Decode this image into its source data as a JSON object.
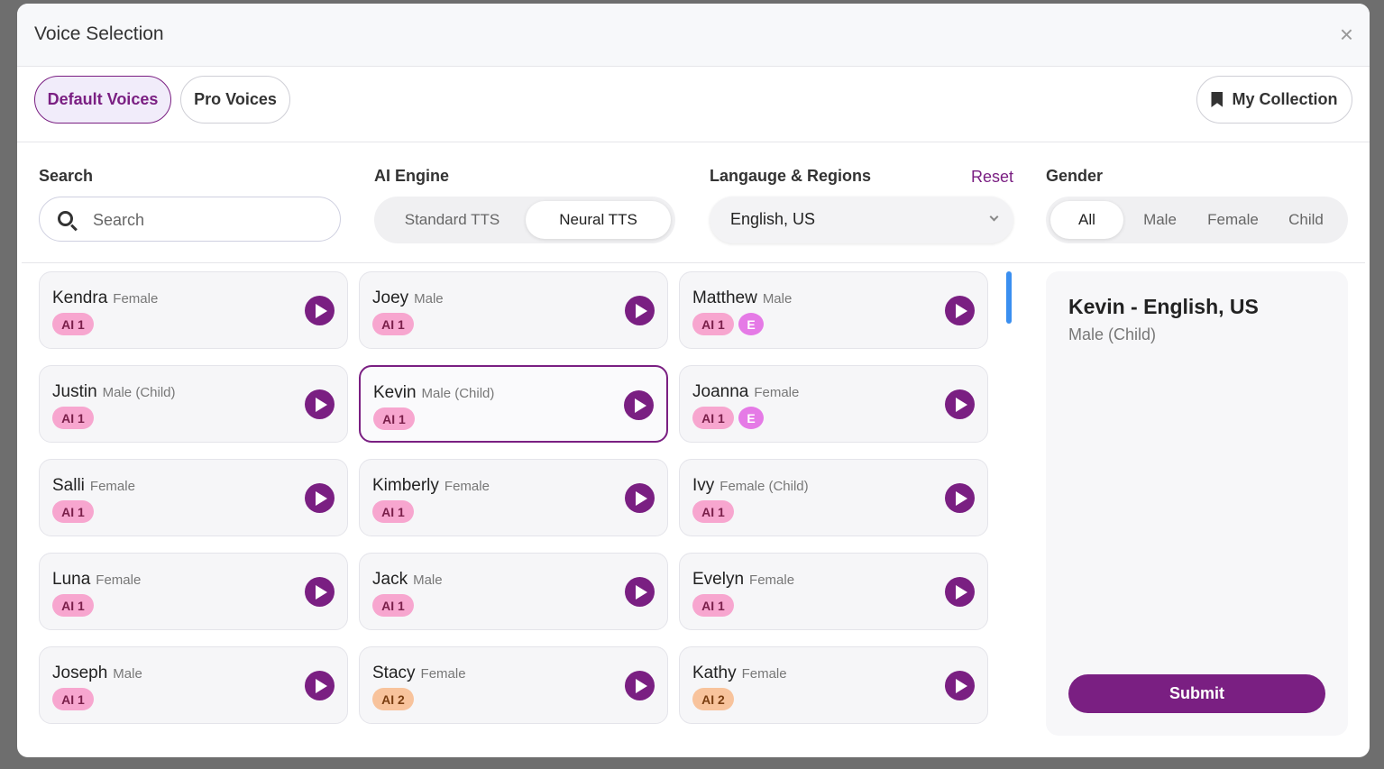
{
  "modal": {
    "title": "Voice Selection",
    "close": "×"
  },
  "tabs": {
    "default": "Default Voices",
    "pro": "Pro Voices",
    "collection": "My Collection"
  },
  "filters": {
    "search_label": "Search",
    "search_placeholder": "Search",
    "engine_label": "AI Engine",
    "engine_options": [
      "Standard TTS",
      "Neural TTS"
    ],
    "engine_selected": "Neural TTS",
    "lang_label": "Langauge & Regions",
    "reset": "Reset",
    "lang_value": "English, US",
    "gender_label": "Gender",
    "gender_options": [
      "All",
      "Male",
      "Female",
      "Child"
    ],
    "gender_selected": "All"
  },
  "voices": [
    {
      "name": "Kendra",
      "gender": "Female",
      "badges": [
        "AI 1"
      ]
    },
    {
      "name": "Joey",
      "gender": "Male",
      "badges": [
        "AI 1"
      ]
    },
    {
      "name": "Matthew",
      "gender": "Male",
      "badges": [
        "AI 1",
        "E"
      ]
    },
    {
      "name": "Justin",
      "gender": "Male (Child)",
      "badges": [
        "AI 1"
      ]
    },
    {
      "name": "Kevin",
      "gender": "Male (Child)",
      "badges": [
        "AI 1"
      ],
      "selected": true
    },
    {
      "name": "Joanna",
      "gender": "Female",
      "badges": [
        "AI 1",
        "E"
      ]
    },
    {
      "name": "Salli",
      "gender": "Female",
      "badges": [
        "AI 1"
      ]
    },
    {
      "name": "Kimberly",
      "gender": "Female",
      "badges": [
        "AI 1"
      ]
    },
    {
      "name": "Ivy",
      "gender": "Female (Child)",
      "badges": [
        "AI 1"
      ]
    },
    {
      "name": "Luna",
      "gender": "Female",
      "badges": [
        "AI 1"
      ]
    },
    {
      "name": "Jack",
      "gender": "Male",
      "badges": [
        "AI 1"
      ]
    },
    {
      "name": "Evelyn",
      "gender": "Female",
      "badges": [
        "AI 1"
      ]
    },
    {
      "name": "Joseph",
      "gender": "Male",
      "badges": [
        "AI 1"
      ]
    },
    {
      "name": "Stacy",
      "gender": "Female",
      "badges": [
        "AI 2"
      ]
    },
    {
      "name": "Kathy",
      "gender": "Female",
      "badges": [
        "AI 2"
      ]
    }
  ],
  "details": {
    "title": "Kevin - English, US",
    "subtitle": "Male (Child)",
    "submit": "Submit"
  },
  "colors": {
    "accent": "#7a1f82",
    "badge_ai1": "#f7a6cf",
    "badge_ai2": "#f8c39c",
    "badge_e": "#e57ae6",
    "scroll": "#3b8ff0"
  }
}
